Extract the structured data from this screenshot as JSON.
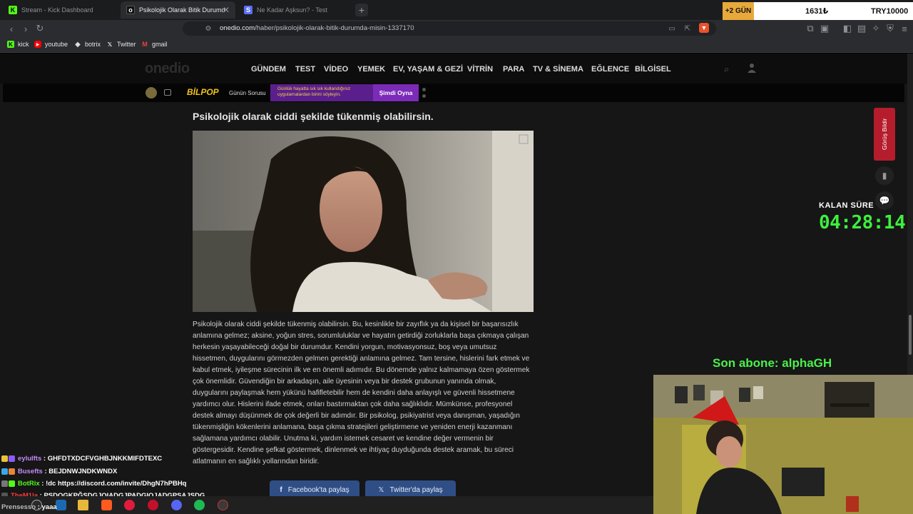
{
  "browser": {
    "tabs": [
      {
        "title": "Stream - Kick Dashboard",
        "favicon": "kick-icon",
        "color": "#53fc18",
        "active": false
      },
      {
        "title": "Psikolojik Olarak Bitik Durumda...",
        "favicon": "onedio-icon",
        "color": "#202020",
        "active": true
      },
      {
        "title": "Ne Kadar Aşksun? - Test",
        "favicon": "test-icon",
        "color": "#7b68ee",
        "active": false
      }
    ],
    "url_domain": "onedio.com",
    "url_path": "/haber/psikolojik-olarak-bitik-durumda-misin-1337170",
    "bookmarks": [
      {
        "label": "kick",
        "icon": "kick-icon",
        "color": "#53fc18"
      },
      {
        "label": "youtube",
        "icon": "youtube-icon",
        "color": "#ff0000"
      },
      {
        "label": "botrix",
        "icon": "botrix-icon",
        "color": "#dddddd"
      },
      {
        "label": "Twitter",
        "icon": "x-icon",
        "color": "#ffffff"
      },
      {
        "label": "gmail",
        "icon": "gmail-icon",
        "color": "#ea4335"
      }
    ]
  },
  "stream_stats": {
    "days": "+2 GÜN",
    "amount": "1631₺",
    "goal": "TRY10000"
  },
  "site": {
    "logo": "onedio",
    "nav": [
      "GÜNDEM",
      "TEST",
      "VİDEO",
      "YEMEK",
      "EV, YAŞAM & GEZİ",
      "VİTRİN",
      "PARA",
      "TV & SİNEMA",
      "EĞLENCE",
      "BİLGİSEL"
    ],
    "game_banner": {
      "brand": "BİLPOP",
      "label": "Günün Sorusu",
      "question": "Günlük hayatta sık sık kullandığınız uygulamalardan birini söyleyin.",
      "cta": "Şimdi Oyna"
    },
    "feedback": "Görüş Bildir"
  },
  "article": {
    "heading": "Psikolojik olarak ciddi şekilde tükenmiş olabilirsin.",
    "body": "Psikolojik olarak ciddi şekilde tükenmiş olabilirsin. Bu, kesinlikle bir zayıflık ya da kişisel bir başarısızlık anlamına gelmez; aksine, yoğun stres, sorumluluklar ve hayatın getirdiği zorluklarla başa çıkmaya çalışan herkesin yaşayabileceği doğal bir durumdur. Kendini yorgun, motivasyonsuz, boş veya umutsuz hissetmen, duygularını görmezden gelmen gerektiği anlamına gelmez. Tam tersine, hislerini fark etmek ve kabul etmek, iyileşme sürecinin ilk ve en önemli adımıdır. Bu dönemde yalnız kalmamaya özen göstermek çok önemlidir. Güvendiğin bir arkadaşın, aile üyesinin veya bir destek grubunun yanında olmak, duygularını paylaşmak hem yükünü hafifletebilir hem de kendini daha anlayışlı ve güvenli hissetmene yardımcı olur. Hislerini ifade etmek, onları bastırmaktan çok daha sağlıklıdır. Mümkünse, profesyonel destek almayı düşünmek de çok değerli bir adımdır. Bir psikolog, psikiyatrist veya danışman, yaşadığın tükenmişliğin kökenlerini anlamana, başa çıkma stratejileri geliştirmene ve yeniden enerji kazanmanı sağlamana yardımcı olabilir. Unutma ki, yardım istemek cesaret ve kendine değer vermenin bir göstergesidir. Kendine şefkat göstermek, dinlenmek ve ihtiyaç duyduğunda destek aramak, bu süreci atlatmanın en sağlıklı yollarından biridir.",
    "share_facebook": "Facebook'ta paylaş",
    "share_twitter": "Twitter'da paylaş"
  },
  "overlay": {
    "timer_label": "KALAN SÜRE",
    "timer": "04:28:14",
    "last_sub": "Son abone: alphaGH"
  },
  "chat": [
    {
      "user": "eylulfts",
      "color": "#c58af9",
      "message": "GHFDTXDCFVGHBJNKKMIFDTEXC"
    },
    {
      "user": "Busefts",
      "color": "#c58af9",
      "message": "BEJDNWJNDKWNDX"
    },
    {
      "user": "BotRix",
      "color": "#53fc18",
      "message": "!dc https://discord.com/invite/DhgN7hPBHq"
    },
    {
      "user": "TheM1la",
      "color": "#ff3b3b",
      "message": "PSDOGKPĞSDGJOIADGJPADGIOJADGPSAJSDG"
    },
    {
      "user": "Prensesso",
      "color": "#bbbbbb",
      "message": "yaaa"
    }
  ]
}
